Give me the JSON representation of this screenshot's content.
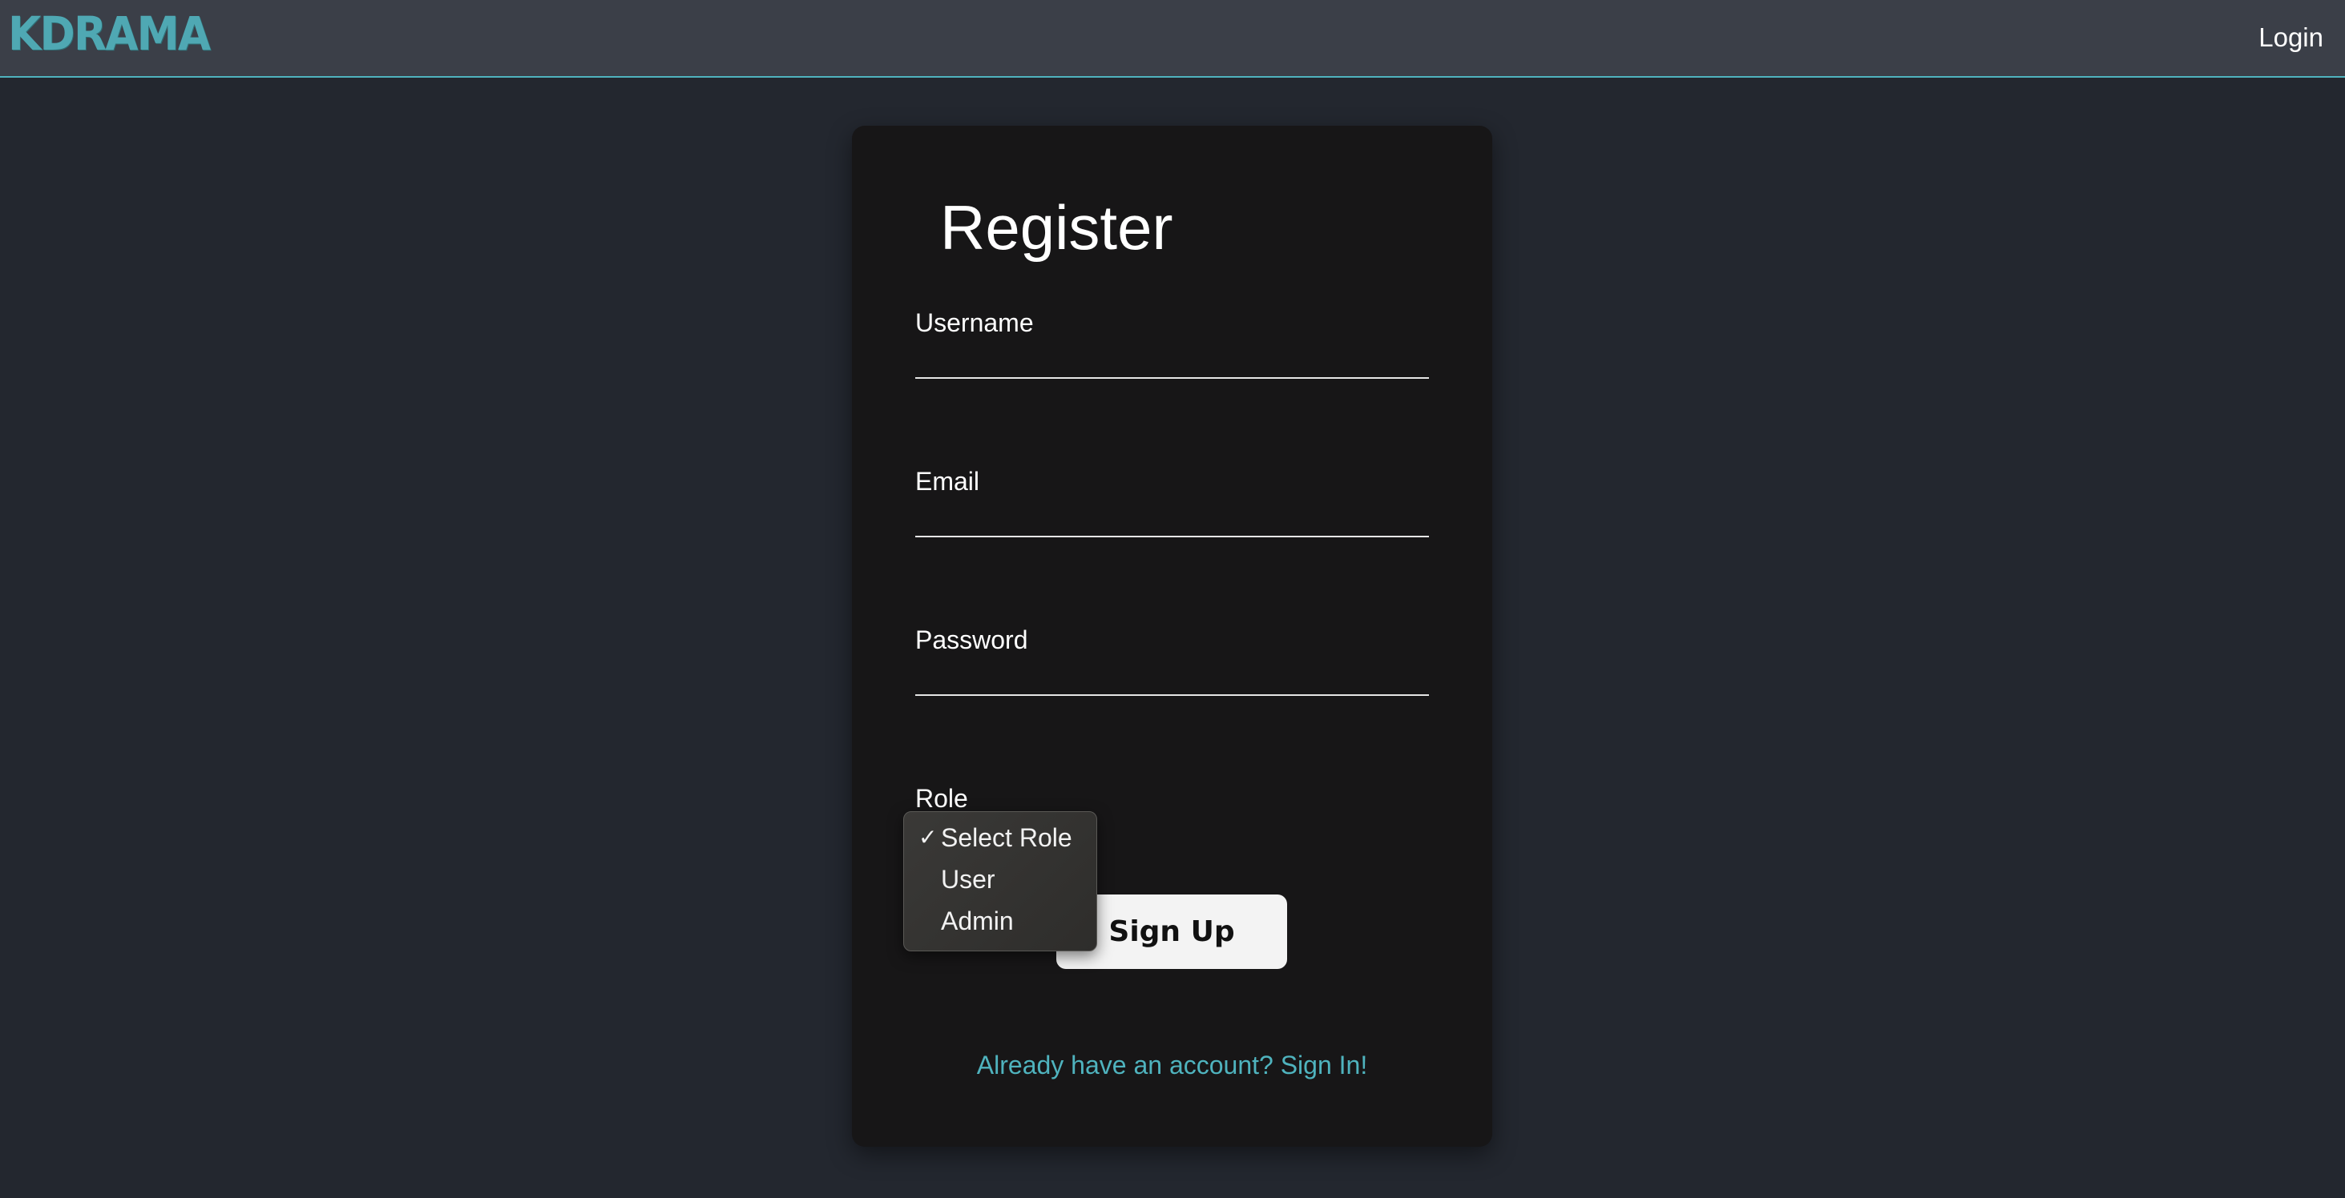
{
  "navbar": {
    "logo": "KDRAMA",
    "login_label": "Login"
  },
  "form": {
    "title": "Register",
    "fields": [
      {
        "label": "Username",
        "value": ""
      },
      {
        "label": "Email",
        "value": ""
      },
      {
        "label": "Password",
        "value": ""
      }
    ],
    "role_label": "Role",
    "role_options": [
      "Select Role",
      "User",
      "Admin"
    ],
    "role_selected": "Select Role",
    "submit_label": "Sign Up",
    "signin_link": "Already have an account? Sign In!"
  },
  "colors": {
    "accent": "#4fb3be",
    "navbar_bg": "#3b3f48",
    "page_bg": "#23272f",
    "card_bg": "#171617"
  }
}
